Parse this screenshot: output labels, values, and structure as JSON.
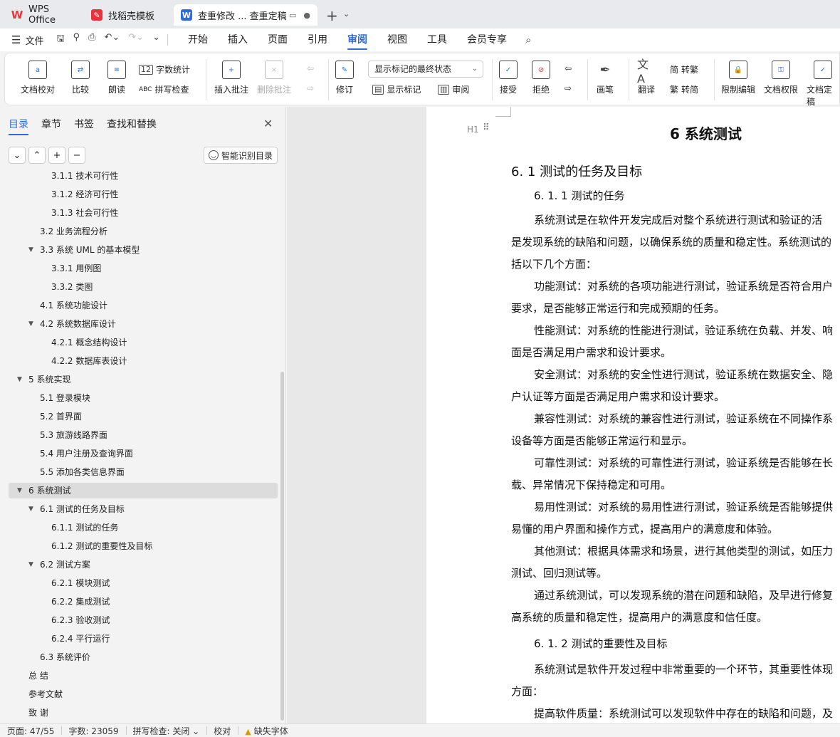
{
  "tabs": {
    "wps": "WPS Office",
    "template": "找稻壳模板",
    "doc": "查重修改 ... 查重定稿"
  },
  "menu": {
    "file": "文件",
    "tabs": [
      "开始",
      "插入",
      "页面",
      "引用",
      "审阅",
      "视图",
      "工具",
      "会员专享"
    ],
    "active": "审阅"
  },
  "ribbon": {
    "proof": "文档校对",
    "compare": "比较",
    "read": "朗读",
    "wordcount": "字数统计",
    "spellcheck": "拼写检查",
    "insert_comment": "插入批注",
    "delete_comment": "删除批注",
    "track": "修订",
    "markup_dropdown": "显示标记的最终状态",
    "show_markup": "显示标记",
    "review": "审阅",
    "accept": "接受",
    "reject": "拒绝",
    "pen": "画笔",
    "translate": "翻译",
    "to_trad": "转繁",
    "to_simp": "转简",
    "restrict": "限制编辑",
    "permission": "文档权限",
    "finalize": "文档定稿"
  },
  "nav": {
    "tabs": [
      "目录",
      "章节",
      "书签",
      "查找和替换"
    ],
    "smart_toc": "智能识别目录",
    "toc": [
      {
        "label": "3.1.1  技术可行性",
        "level": 3
      },
      {
        "label": "3.1.2  经济可行性",
        "level": 3
      },
      {
        "label": "3.1.3  社会可行性",
        "level": 3
      },
      {
        "label": "3.2  业务流程分析",
        "level": 2
      },
      {
        "label": "3.3  系统 UML 的基本模型",
        "level": 2,
        "expanded": true
      },
      {
        "label": "3.3.1  用例图",
        "level": 3
      },
      {
        "label": "3.3.2  类图",
        "level": 3
      },
      {
        "label": "4.1  系统功能设计",
        "level": 2
      },
      {
        "label": "4.2  系统数据库设计",
        "level": 2,
        "expanded": true
      },
      {
        "label": "4.2.1  概念结构设计",
        "level": 3
      },
      {
        "label": "4.2.2  数据库表设计",
        "level": 3
      },
      {
        "label": "5  系统实现",
        "level": 1,
        "expanded": true
      },
      {
        "label": "5.1 登录模块",
        "level": 2
      },
      {
        "label": "5.2  首界面",
        "level": 2
      },
      {
        "label": "5.3  旅游线路界面",
        "level": 2
      },
      {
        "label": "5.4  用户注册及查询界面",
        "level": 2
      },
      {
        "label": "5.5  添加各类信息界面",
        "level": 2
      },
      {
        "label": "6  系统测试",
        "level": 1,
        "expanded": true,
        "selected": true
      },
      {
        "label": "6.1 测试的任务及目标",
        "level": 2,
        "expanded": true
      },
      {
        "label": "6.1.1 测试的任务",
        "level": 3
      },
      {
        "label": "6.1.2 测试的重要性及目标",
        "level": 3
      },
      {
        "label": "6.2 测试方案",
        "level": 2,
        "expanded": true
      },
      {
        "label": "6.2.1 模块测试",
        "level": 3
      },
      {
        "label": "6.2.2 集成测试",
        "level": 3
      },
      {
        "label": "6.2.3 验收测试",
        "level": 3
      },
      {
        "label": "6.2.4 平行运行",
        "level": 3
      },
      {
        "label": "6.3 系统评价",
        "level": 2
      },
      {
        "label": "总    结",
        "level": 1
      },
      {
        "label": "参考文献",
        "level": 1
      },
      {
        "label": "致    谢",
        "level": 1
      }
    ]
  },
  "doc": {
    "h1": "6  系统测试",
    "h2": "6. 1 测试的任务及目标",
    "h3a": "6. 1. 1 测试的任务",
    "h3b": "6. 1. 2 测试的重要性及目标",
    "lines": [
      "系统测试是在软件开发完成后对整个系统进行测试和验证的活",
      "是发现系统的缺陷和问题，以确保系统的质量和稳定性。系统测试的",
      "括以下几个方面：",
      "功能测试：对系统的各项功能进行测试，验证系统是否符合用户",
      "要求，是否能够正常运行和完成预期的任务。",
      "性能测试：对系统的性能进行测试，验证系统在负载、并发、响",
      "面是否满足用户需求和设计要求。",
      "安全测试：对系统的安全性进行测试，验证系统在数据安全、隐",
      "户认证等方面是否满足用户需求和设计要求。",
      "兼容性测试：对系统的兼容性进行测试，验证系统在不同操作系",
      "设备等方面是否能够正常运行和显示。",
      "可靠性测试：对系统的可靠性进行测试，验证系统是否能够在长",
      "载、异常情况下保持稳定和可用。",
      "易用性测试：对系统的易用性进行测试，验证系统是否能够提供",
      "易懂的用户界面和操作方式，提高用户的满意度和体验。",
      "其他测试：根据具体需求和场景，进行其他类型的测试，如压力",
      "测试、回归测试等。",
      "通过系统测试，可以发现系统的潜在问题和缺陷，及早进行修复",
      "高系统的质量和稳定性，提高用户的满意度和信任度。"
    ],
    "lines2": [
      "系统测试是软件开发过程中非常重要的一个环节，其重要性体现",
      "方面：",
      "提高软件质量：系统测试可以发现软件中存在的缺陷和问题，及"
    ]
  },
  "status": {
    "page": "页面: 47/55",
    "words": "字数: 23059",
    "spell": "拼写检查: 关闭",
    "proof": "校对",
    "missing_font": "缺失字体"
  }
}
